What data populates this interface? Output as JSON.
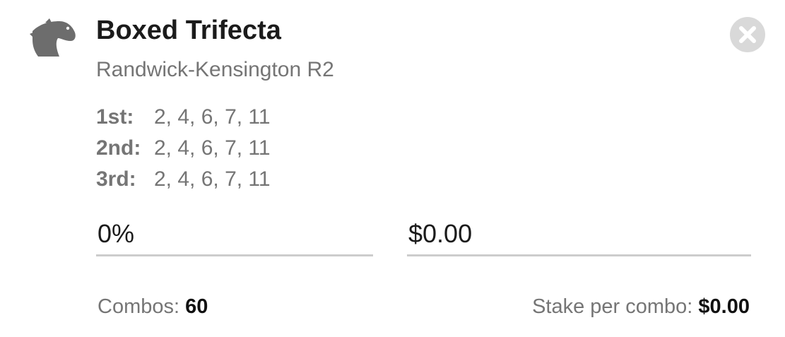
{
  "bet": {
    "title": "Boxed Trifecta",
    "race": "Randwick-Kensington R2",
    "icon": "horse-head-icon",
    "places": [
      {
        "label": "1st:",
        "runners": "2, 4, 6, 7, 11"
      },
      {
        "label": "2nd:",
        "runners": "2, 4, 6, 7, 11"
      },
      {
        "label": "3rd:",
        "runners": "2, 4, 6, 7, 11"
      }
    ]
  },
  "inputs": {
    "percent_value": "0%",
    "amount_value": "$0.00"
  },
  "summary": {
    "combos_label": "Combos:",
    "combos_value": "60",
    "stake_label": "Stake per combo:",
    "stake_value": "$0.00"
  },
  "controls": {
    "close_icon": "close-icon"
  },
  "colors": {
    "text_dark": "#1b1b1b",
    "text_muted": "#757575",
    "icon_gray": "#6d6d6d",
    "close_bg": "#d9d9d9",
    "underline": "#cccccc"
  }
}
